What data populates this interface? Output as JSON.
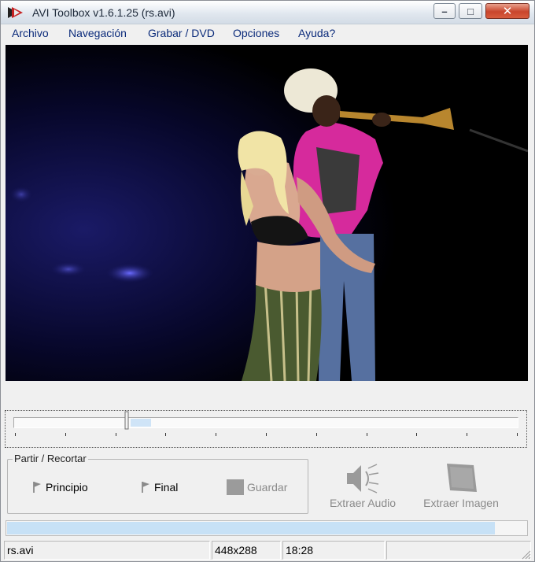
{
  "window": {
    "title": "AVI Toolbox v1.6.1.25 (rs.avi)",
    "controls": {
      "minimize": "–",
      "maximize": "□",
      "close": "✕"
    }
  },
  "menu": {
    "items": [
      "Archivo",
      "Navegación",
      "Grabar / DVD",
      "Opciones",
      "Ayuda?"
    ]
  },
  "seek": {
    "position": 0.225
  },
  "split_group": {
    "title": "Partir / Recortar",
    "start_label": "Principio",
    "end_label": "Final",
    "save_label": "Guardar"
  },
  "actions": {
    "extract_audio_label": "Extraer Audio",
    "extract_image_label": "Extraer Imagen"
  },
  "progress": {
    "value": 0.94
  },
  "status": {
    "file": "rs.avi",
    "resolution": "448x288",
    "duration": "18:28",
    "extra": ""
  },
  "colors": {
    "accent": "#0a2a7a",
    "progress_fill": "#c7e1f6",
    "close_button": "#c9452c"
  }
}
